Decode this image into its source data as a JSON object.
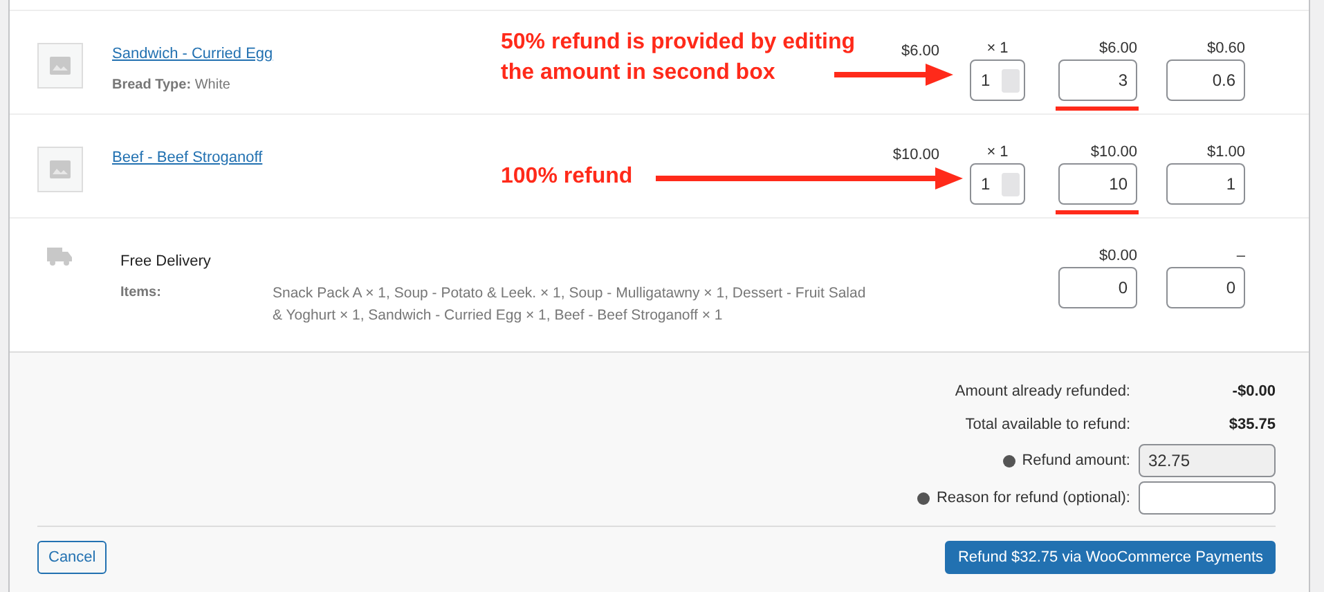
{
  "items": [
    {
      "name": "Sandwich - Curried Egg",
      "meta_label": "Bread Type:",
      "meta_value": "White",
      "cost": "$6.00",
      "qty_label": "× 1",
      "qty_value": "1",
      "total": "$6.00",
      "total_value": "3",
      "tax": "$0.60",
      "tax_value": "0.6",
      "underlined": true,
      "note": "50% refund is provided by editing the amount in second box"
    },
    {
      "name": "Beef - Beef Stroganoff",
      "cost": "$10.00",
      "qty_label": "× 1",
      "qty_value": "1",
      "total": "$10.00",
      "total_value": "10",
      "tax": "$1.00",
      "tax_value": "1",
      "underlined": true,
      "note": "100% refund"
    }
  ],
  "shipping": {
    "name": "Free Delivery",
    "items_label": "Items:",
    "items_text": "Snack Pack A × 1, Soup - Potato & Leek. × 1, Soup - Mulligatawny × 1, Dessert - Fruit Salad & Yoghurt × 1, Sandwich - Curried Egg × 1, Beef - Beef Stroganoff × 1",
    "total": "$0.00",
    "total_value": "0",
    "tax": "–",
    "tax_value": "0"
  },
  "totals": [
    {
      "kind": "text",
      "label": "Amount already refunded:",
      "value": "-$0.00"
    },
    {
      "kind": "text",
      "label": "Total available to refund:",
      "value": "$35.75"
    },
    {
      "kind": "field",
      "label": "Refund amount:",
      "value": "32.75",
      "disabled": true,
      "help": true
    },
    {
      "kind": "field",
      "label": "Reason for refund (optional):",
      "disabled": false,
      "help": true
    }
  ],
  "buttons": [
    {
      "label": "Cancel",
      "kind": "secondary"
    },
    {
      "label": "Refund $32.75 via WooCommerce Payments",
      "kind": "primary"
    }
  ]
}
